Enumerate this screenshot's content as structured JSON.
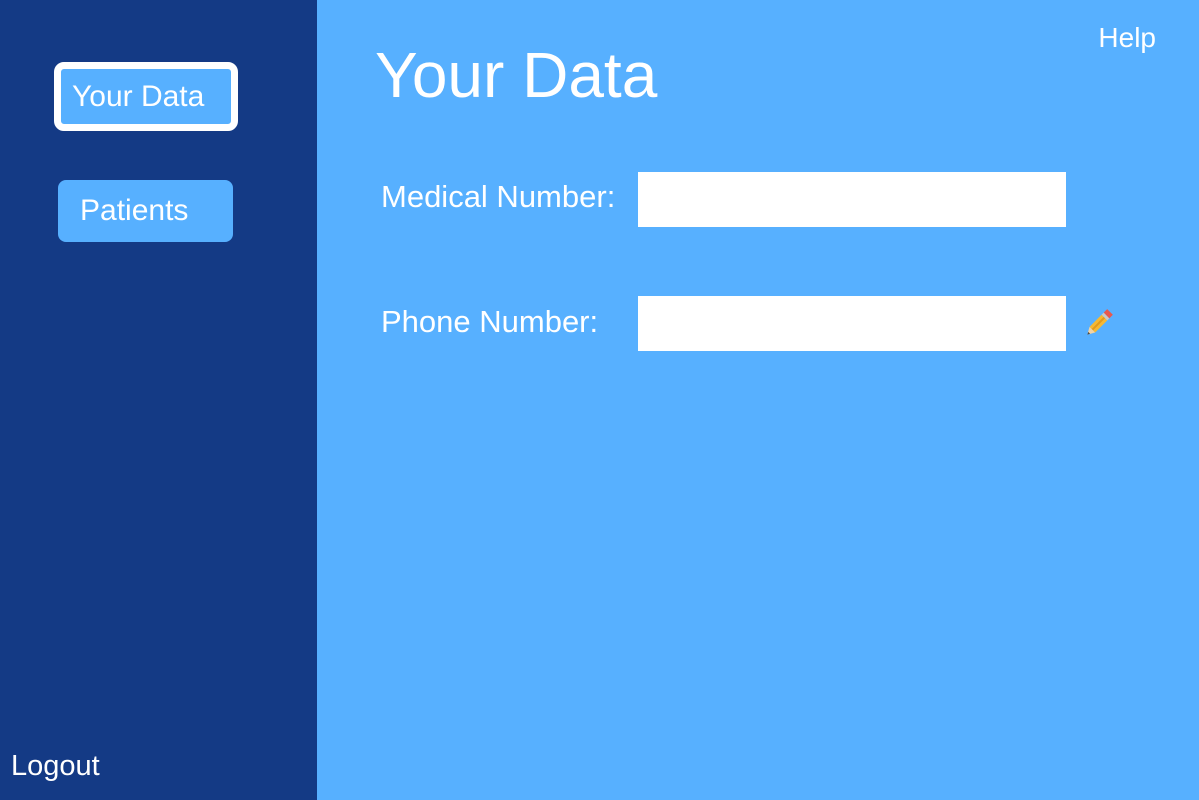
{
  "sidebar": {
    "items": [
      {
        "label": "Your Data",
        "active": true
      },
      {
        "label": "Patients",
        "active": false
      }
    ],
    "logout_label": "Logout"
  },
  "header": {
    "help_label": "Help"
  },
  "main": {
    "title": "Your Data",
    "fields": [
      {
        "label": "Medical Number:",
        "value": "",
        "icon": null
      },
      {
        "label": "Phone Number:",
        "value": "",
        "icon": "pencil-icon"
      }
    ]
  },
  "colors": {
    "sidebar_bg": "#143a85",
    "main_bg": "#57b0ff",
    "text": "#ffffff",
    "input_bg": "#ffffff"
  }
}
